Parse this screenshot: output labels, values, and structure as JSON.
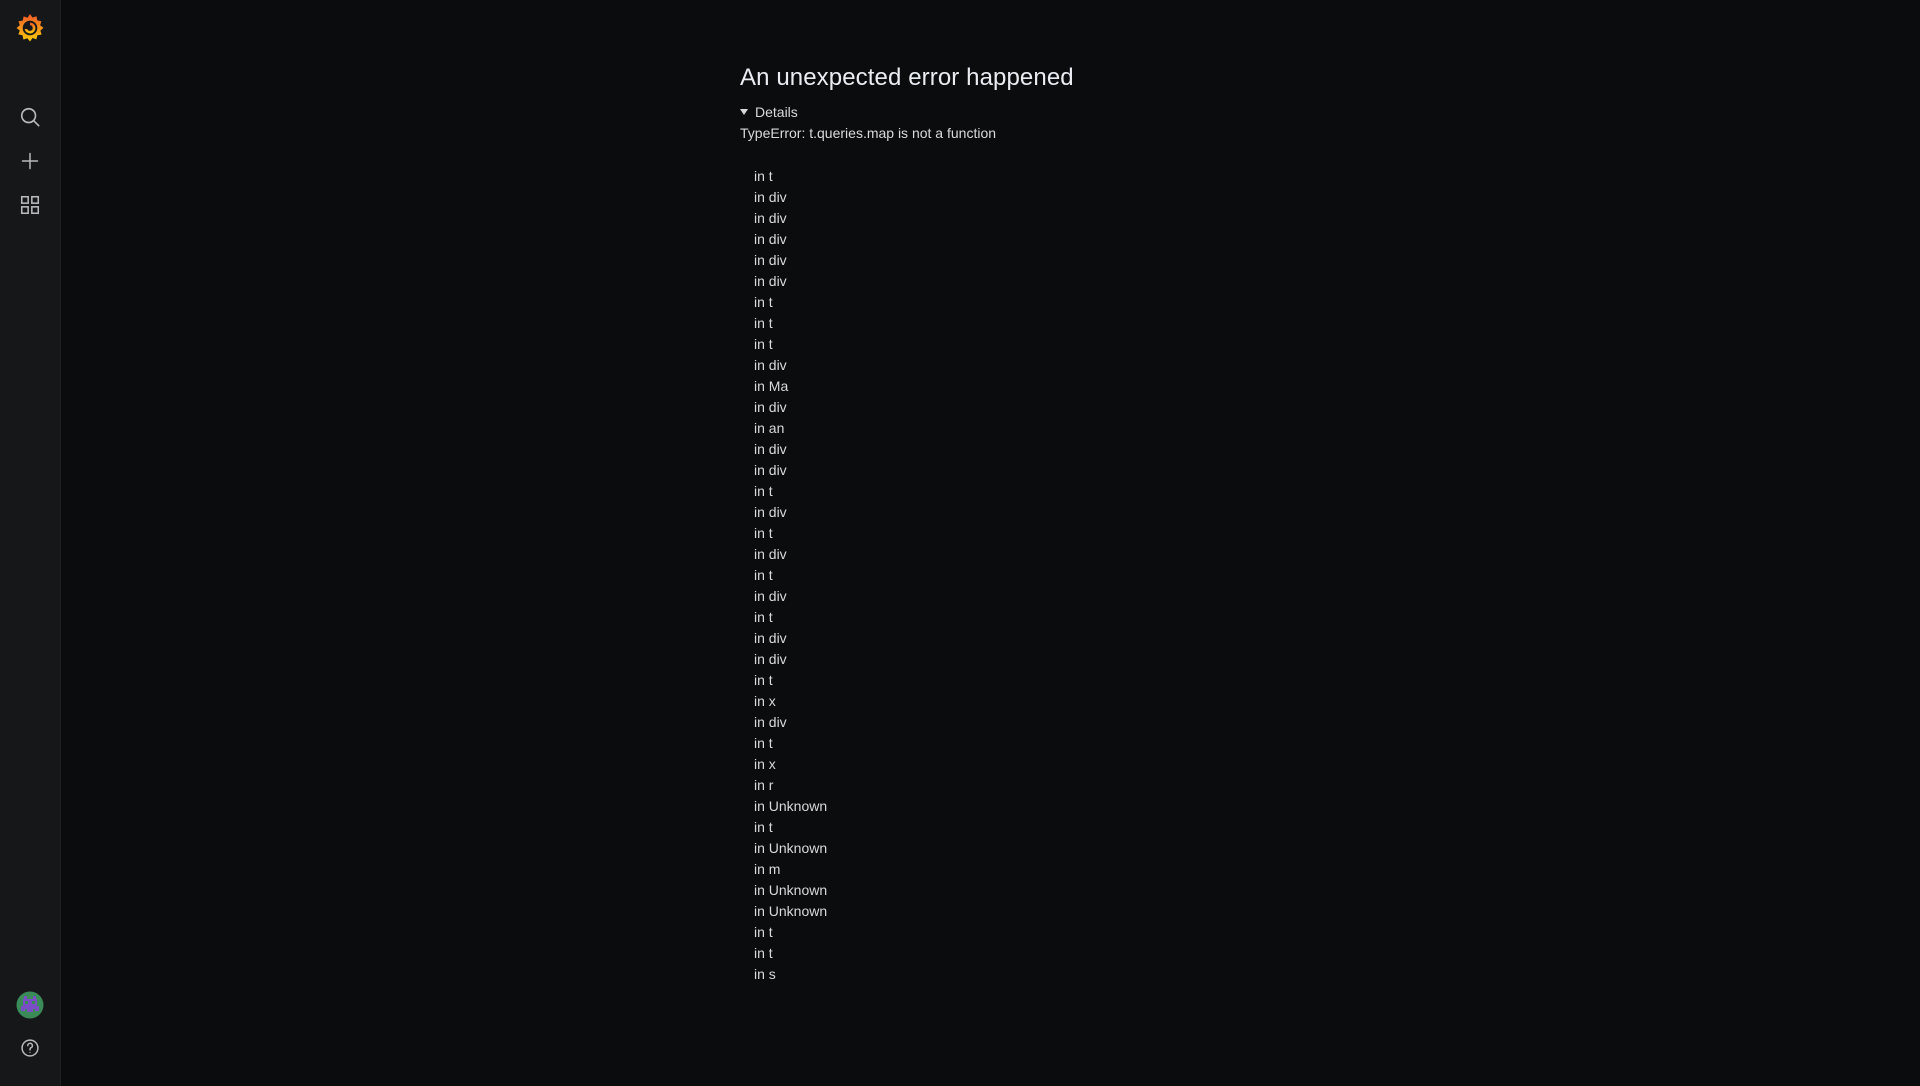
{
  "sidebar": {
    "logo": "grafana-logo",
    "items": [
      {
        "name": "search",
        "icon": "search-icon"
      },
      {
        "name": "create",
        "icon": "plus-icon"
      },
      {
        "name": "dashboards",
        "icon": "apps-grid-icon"
      }
    ],
    "bottom": [
      {
        "name": "profile",
        "icon": "avatar"
      },
      {
        "name": "help",
        "icon": "question-circle-icon"
      }
    ]
  },
  "error": {
    "title": "An unexpected error happened",
    "details_label": "Details",
    "message": "TypeError: t.queries.map is not a function",
    "stack": [
      "in t",
      "in div",
      "in div",
      "in div",
      "in div",
      "in div",
      "in t",
      "in t",
      "in t",
      "in div",
      "in Ma",
      "in div",
      "in an",
      "in div",
      "in div",
      "in t",
      "in div",
      "in t",
      "in div",
      "in t",
      "in div",
      "in t",
      "in div",
      "in div",
      "in t",
      "in x",
      "in div",
      "in t",
      "in x",
      "in r",
      "in Unknown",
      "in t",
      "in Unknown",
      "in m",
      "in Unknown",
      "in Unknown",
      "in t",
      "in t",
      "in s"
    ]
  },
  "colors": {
    "background": "#0b0c0e",
    "sidebar": "#161719",
    "text": "#d8d9da",
    "logo_orange": "#f05a28",
    "logo_yellow": "#fbca0a"
  }
}
